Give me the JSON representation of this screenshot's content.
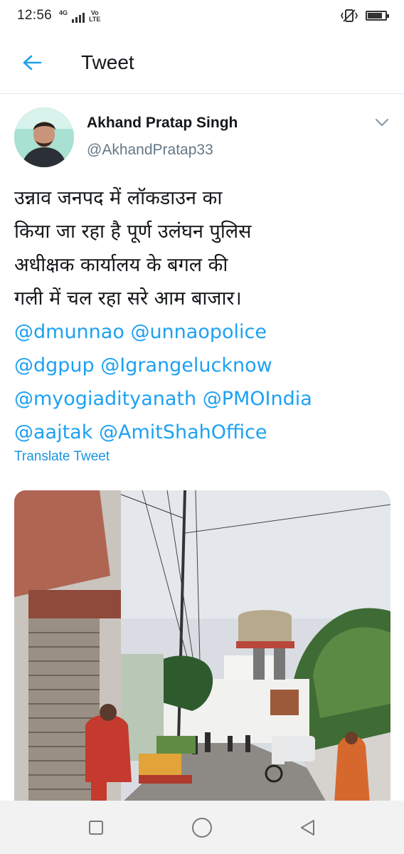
{
  "status_bar": {
    "time": "12:56",
    "network_label": "4G",
    "volte_label_top": "Vo",
    "volte_label_bottom": "LTE",
    "signal_bars": 4,
    "battery_fraction": 0.85
  },
  "header": {
    "title": "Tweet"
  },
  "tweet": {
    "author_name": "Akhand Pratap Singh",
    "author_handle": "@AkhandPratap33",
    "text_lines": [
      "उन्नाव जनपद में लॉकडाउन का",
      "किया जा रहा है पूर्ण उलंघन पुलिस",
      "अधीक्षक कार्यालय के बगल की",
      "गली में चल रहा सरे आम बाजार।"
    ],
    "mention_lines": [
      [
        "@dmunnao",
        "@unnaopolice"
      ],
      [
        "@dgpup",
        "@Igrangelucknow"
      ],
      [
        "@myogiadityanath",
        "@PMOIndia"
      ],
      [
        "@aajtak",
        "@AmitShahOffice"
      ]
    ],
    "translate_label": "Translate Tweet"
  },
  "icons": {
    "back": "arrow-left-icon",
    "caret": "chevron-down-icon",
    "nav_recent": "square-icon",
    "nav_home": "circle-icon",
    "nav_back": "triangle-back-icon"
  },
  "colors": {
    "accent": "#1da1f2",
    "link": "#1b95e0",
    "secondary_text": "#657786",
    "divider": "#e1e8ed"
  }
}
